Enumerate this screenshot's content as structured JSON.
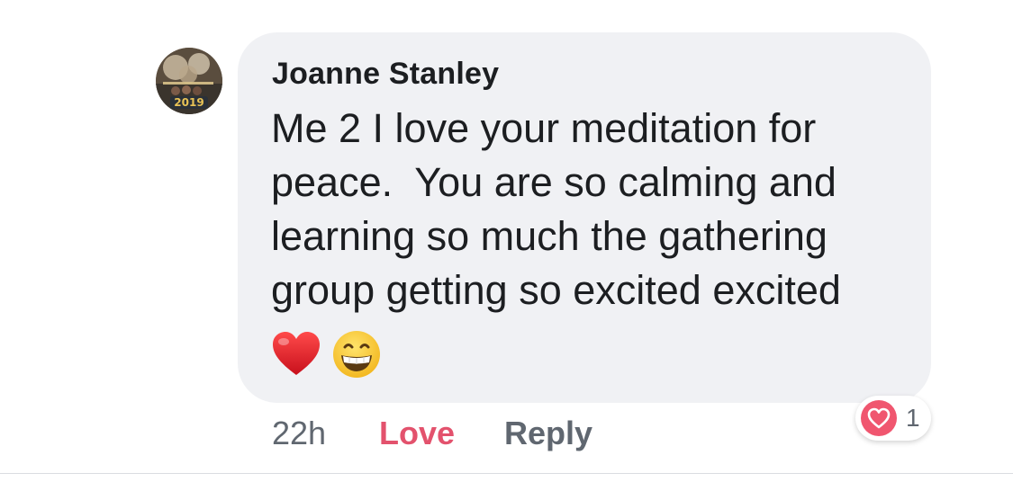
{
  "comment": {
    "author": "Joanne Stanley",
    "text": "Me 2 I love your meditation for\npeace.  You are so calming and\nlearning so much the gathering\ngroup getting so excited excited",
    "emojis": [
      "red-heart-icon",
      "grinning-face-icon"
    ],
    "timestamp": "22h",
    "love_label": "Love",
    "reply_label": "Reply",
    "reaction": {
      "icon": "heart-reaction-icon",
      "count": "1"
    },
    "avatar_overlay_text": "2019"
  },
  "colors": {
    "bubble": "#f0f1f4",
    "author": "#1c1e21",
    "meta": "#606770",
    "love": "#e3526d",
    "reaction_heart": "#f0566f"
  }
}
